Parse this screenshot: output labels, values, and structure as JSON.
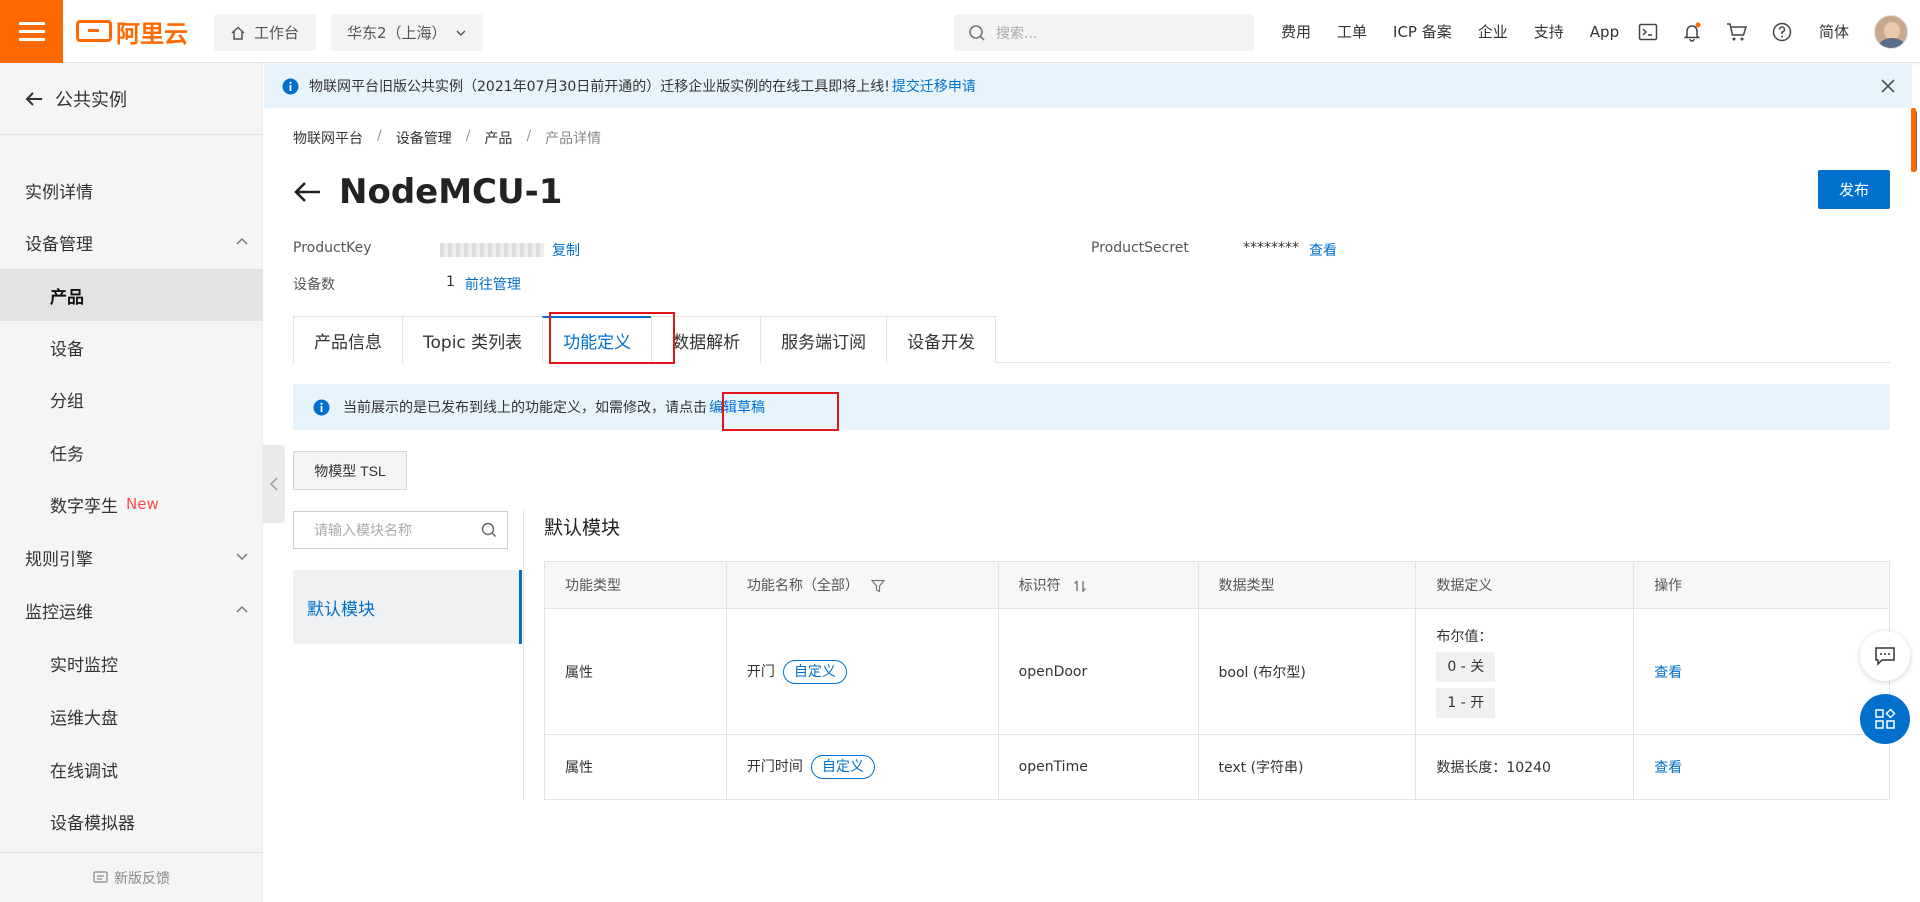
{
  "topbar": {
    "logo_text": "阿里云",
    "workbench": "工作台",
    "region": "华东2（上海）",
    "search_placeholder": "搜索...",
    "nav": [
      "费用",
      "工单",
      "ICP 备案",
      "企业",
      "支持",
      "App"
    ],
    "lang": "简体"
  },
  "sidebar": {
    "back_label": "公共实例",
    "items": [
      {
        "label": "实例详情",
        "level": 1
      },
      {
        "label": "设备管理",
        "level": 1,
        "expanded": true
      },
      {
        "label": "产品",
        "level": 2,
        "active": true
      },
      {
        "label": "设备",
        "level": 2
      },
      {
        "label": "分组",
        "level": 2
      },
      {
        "label": "任务",
        "level": 2
      },
      {
        "label": "数字孪生",
        "level": 2,
        "badge": "New"
      },
      {
        "label": "规则引擎",
        "level": 1,
        "expanded": false
      },
      {
        "label": "监控运维",
        "level": 1,
        "expanded": true
      },
      {
        "label": "实时监控",
        "level": 2
      },
      {
        "label": "运维大盘",
        "level": 2
      },
      {
        "label": "在线调试",
        "level": 2
      },
      {
        "label": "设备模拟器",
        "level": 2
      }
    ],
    "feedback": "新版反馈"
  },
  "notice": {
    "text": "物联网平台旧版公共实例（2021年07月30日前开通的）迁移企业版实例的在线工具即将上线!",
    "link": "提交迁移申请"
  },
  "breadcrumb": [
    "物联网平台",
    "设备管理",
    "产品",
    "产品详情"
  ],
  "product": {
    "name": "NodeMCU-1",
    "publish": "发布",
    "product_key_label": "ProductKey",
    "copy": "复制",
    "product_secret_label": "ProductSecret",
    "product_secret_value": "********",
    "view": "查看",
    "device_count_label": "设备数",
    "device_count": "1",
    "manage_link": "前往管理"
  },
  "tabs": [
    "产品信息",
    "Topic 类列表",
    "功能定义",
    "数据解析",
    "服务端订阅",
    "设备开发"
  ],
  "active_tab": "功能定义",
  "info_bar": {
    "text": "当前展示的是已发布到线上的功能定义，如需修改，请点击",
    "link": "编辑草稿"
  },
  "tsl_button": "物模型 TSL",
  "module_search_placeholder": "请输入模块名称",
  "module_item": "默认模块",
  "section_title": "默认模块",
  "table": {
    "headers": [
      "功能类型",
      "功能名称（全部）",
      "标识符",
      "数据类型",
      "数据定义",
      "操作"
    ],
    "rows": [
      {
        "type": "属性",
        "name": "开门",
        "tag": "自定义",
        "identifier": "openDoor",
        "data_type": "bool (布尔型)",
        "def_label": "布尔值：",
        "def_values": [
          "0 - 关",
          "1 - 开"
        ],
        "action": "查看"
      },
      {
        "type": "属性",
        "name": "开门时间",
        "tag": "自定义",
        "identifier": "openTime",
        "data_type": "text (字符串)",
        "def_text": "数据长度：10240",
        "action": "查看"
      }
    ]
  },
  "colors": {
    "brand_orange": "#ff6a00",
    "primary_blue": "#0070cc",
    "highlight_red": "#e3151c",
    "new_badge": "#ff4d4f"
  }
}
